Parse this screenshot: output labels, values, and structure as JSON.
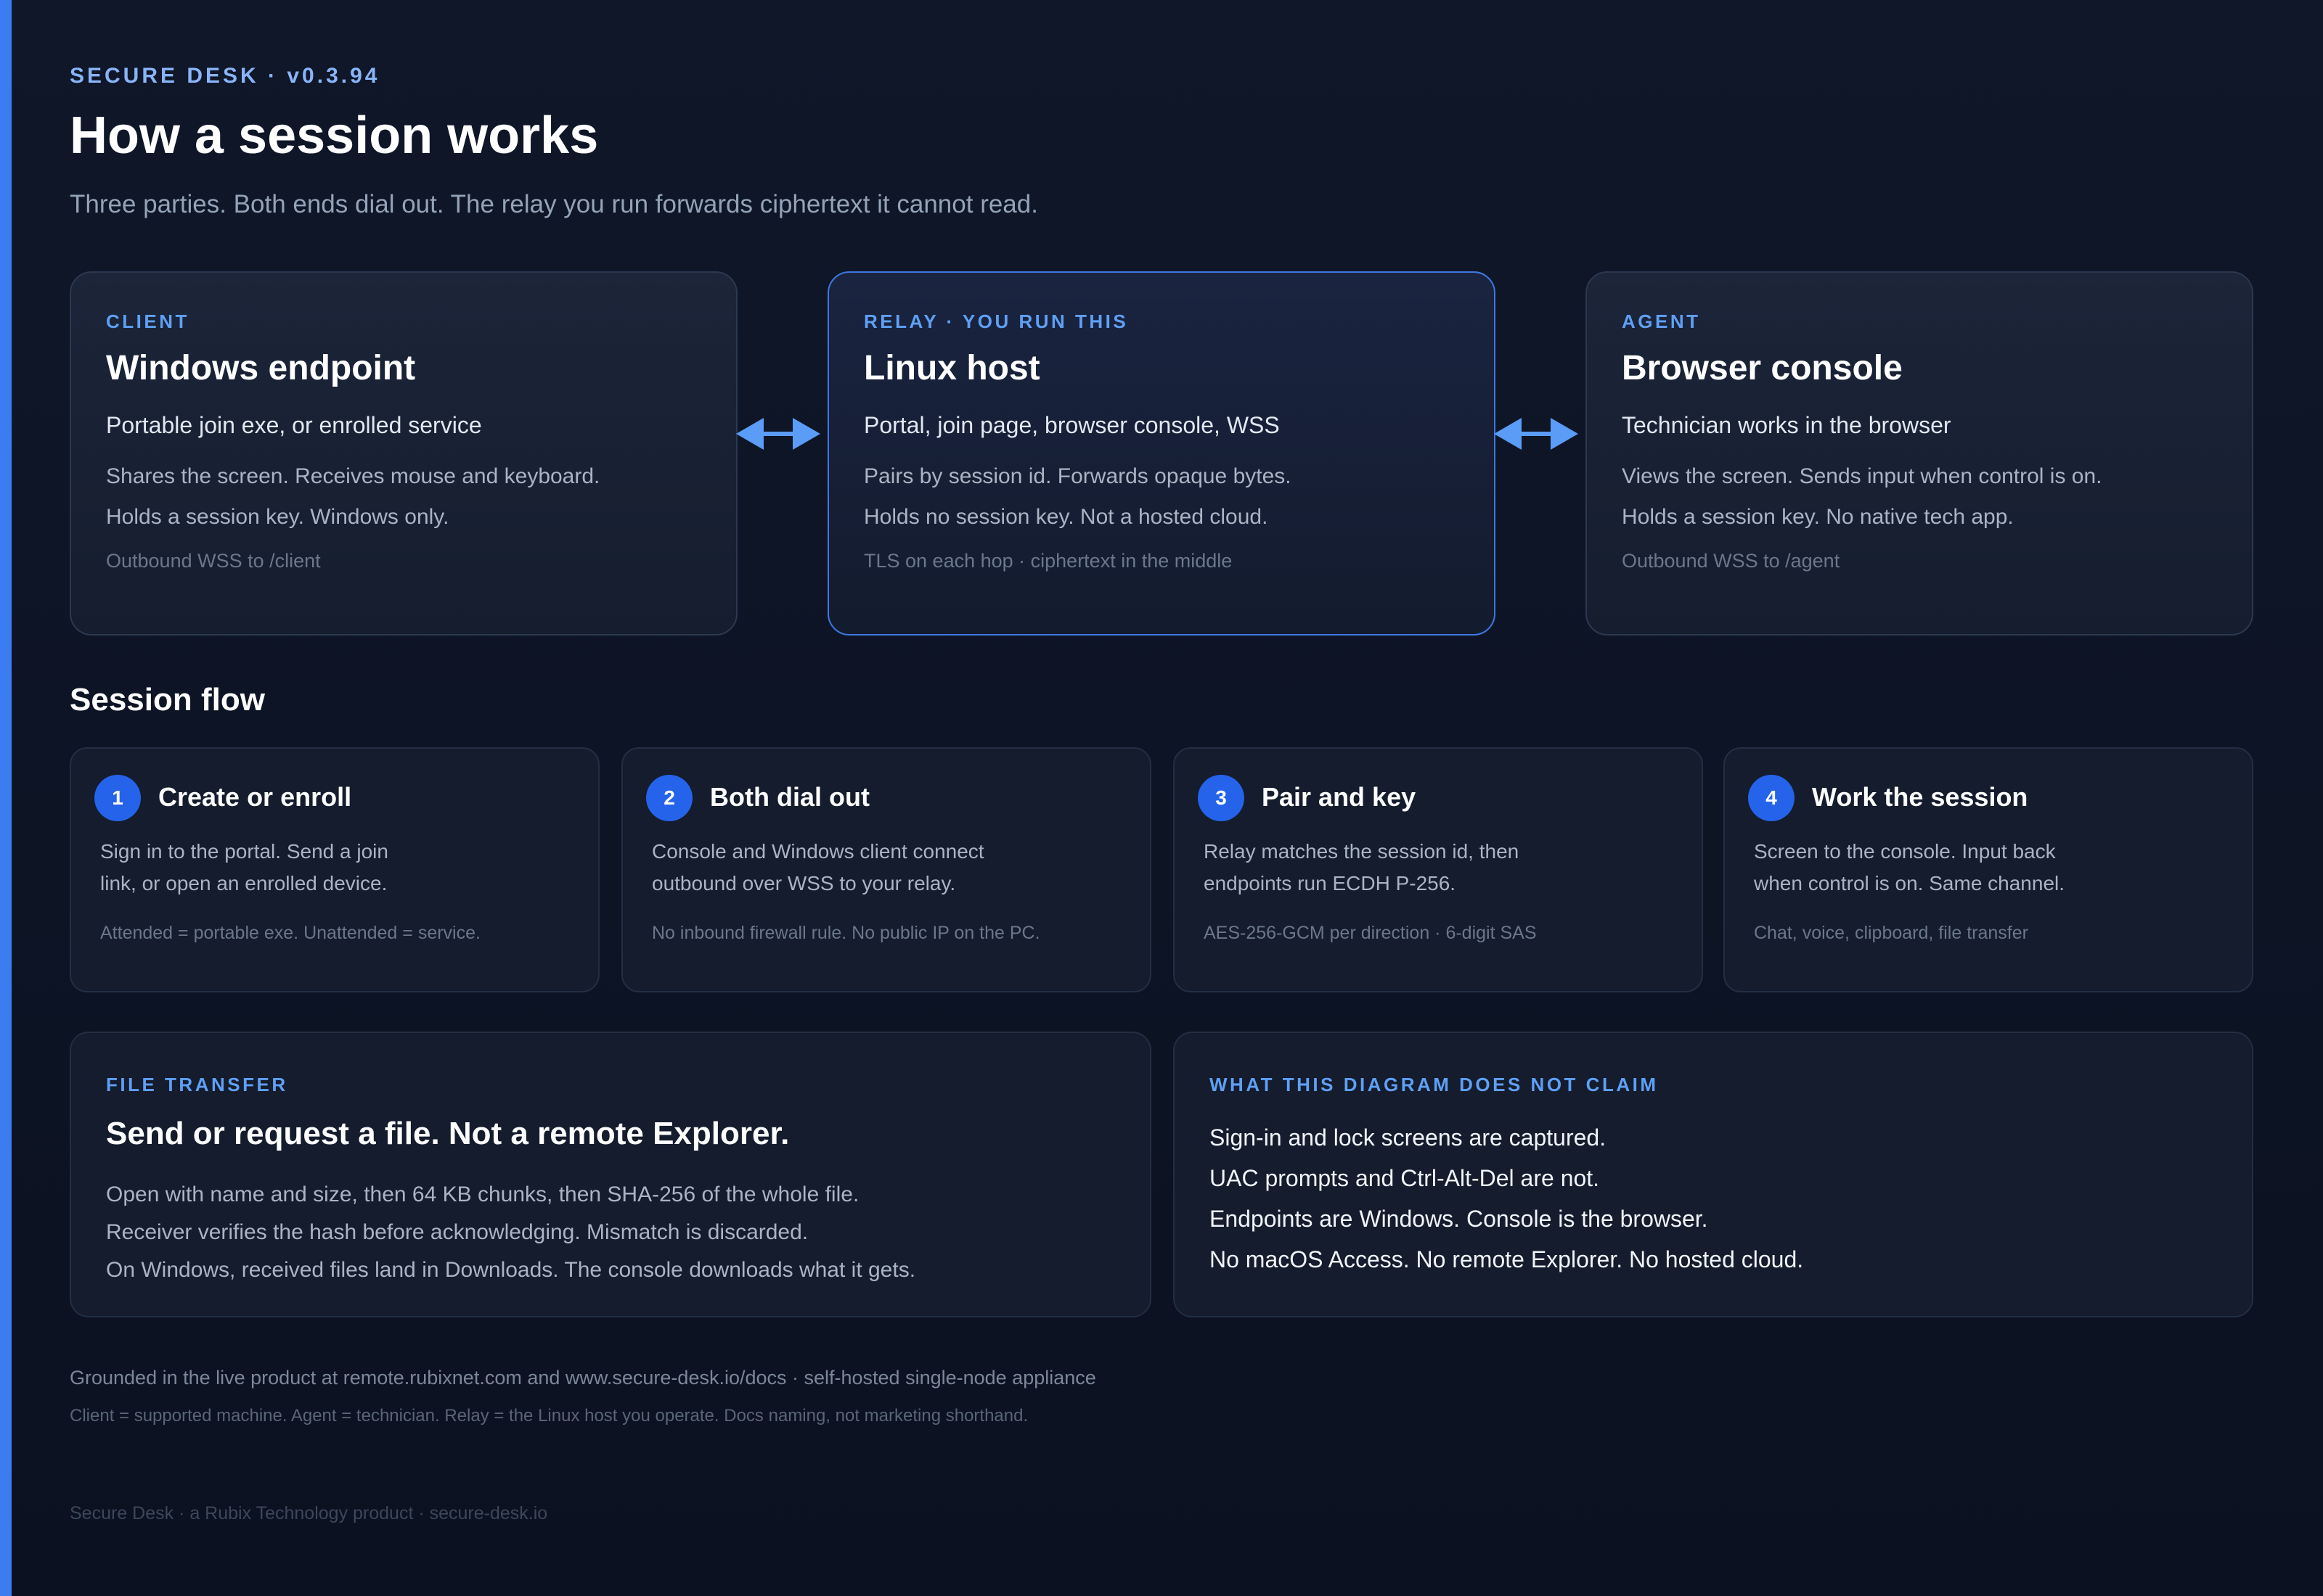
{
  "colors": {
    "accent": "#3b7cf0",
    "background": "#0f1729",
    "eyebrow": "#5fa0f5",
    "step_badge": "#2563eb"
  },
  "header": {
    "eyebrow": "SECURE DESK · v0.3.94",
    "title": "How a session works",
    "subtitle": "Three parties. Both ends dial out. The relay you run forwards ciphertext it cannot read."
  },
  "parties": [
    {
      "eyebrow": "CLIENT",
      "title": "Windows endpoint",
      "subtitle": "Portable join exe, or enrolled service",
      "lines": [
        "Shares the screen. Receives mouse and keyboard.",
        "Holds a session key. Windows only."
      ],
      "footer": "Outbound WSS to /client"
    },
    {
      "eyebrow": "RELAY · YOU RUN THIS",
      "title": "Linux host",
      "subtitle": "Portal, join page, browser console, WSS",
      "lines": [
        "Pairs by session id. Forwards opaque bytes.",
        "Holds no session key. Not a hosted cloud."
      ],
      "footer": "TLS on each hop · ciphertext in the middle"
    },
    {
      "eyebrow": "AGENT",
      "title": "Browser console",
      "subtitle": "Technician works in the browser",
      "lines": [
        "Views the screen. Sends input when control is on.",
        "Holds a session key. No native tech app."
      ],
      "footer": "Outbound WSS to /agent"
    }
  ],
  "connector_icon": "double-arrow-icon",
  "flow": {
    "title": "Session flow",
    "steps": [
      {
        "number": "1",
        "title": "Create or enroll",
        "lines": [
          "Sign in to the portal. Send a join",
          "link, or open an enrolled device."
        ],
        "footer": "Attended = portable exe. Unattended = service."
      },
      {
        "number": "2",
        "title": "Both dial out",
        "lines": [
          "Console and Windows client connect",
          "outbound over WSS to your relay."
        ],
        "footer": "No inbound firewall rule. No public IP on the PC."
      },
      {
        "number": "3",
        "title": "Pair and key",
        "lines": [
          "Relay matches the session id, then",
          "endpoints run ECDH P-256."
        ],
        "footer": "AES-256-GCM per direction · 6-digit SAS"
      },
      {
        "number": "4",
        "title": "Work the session",
        "lines": [
          "Screen to the console. Input back",
          "when control is on. Same channel."
        ],
        "footer": "Chat, voice, clipboard, file transfer"
      }
    ]
  },
  "file_transfer": {
    "eyebrow": "FILE TRANSFER",
    "title": "Send or request a file. Not a remote Explorer.",
    "lines": [
      "Open with name and size, then 64 KB chunks, then SHA-256 of the whole file.",
      "Receiver verifies the hash before acknowledging. Mismatch is discarded.",
      "On Windows, received files land in Downloads. The console downloads what it gets."
    ]
  },
  "claims": {
    "eyebrow": "WHAT THIS DIAGRAM DOES NOT CLAIM",
    "lines": [
      "Sign-in and lock screens are captured.",
      "UAC prompts and Ctrl-Alt-Del are not.",
      "Endpoints are Windows. Console is the browser.",
      "No macOS Access. No remote Explorer. No hosted cloud."
    ]
  },
  "notes": {
    "line1": "Grounded in the live product at remote.rubixnet.com and www.secure-desk.io/docs · self-hosted single-node appliance",
    "line2": "Client = supported machine. Agent = technician. Relay = the Linux host you operate. Docs naming, not marketing shorthand."
  },
  "footer": "Secure Desk · a Rubix Technology product · secure-desk.io"
}
